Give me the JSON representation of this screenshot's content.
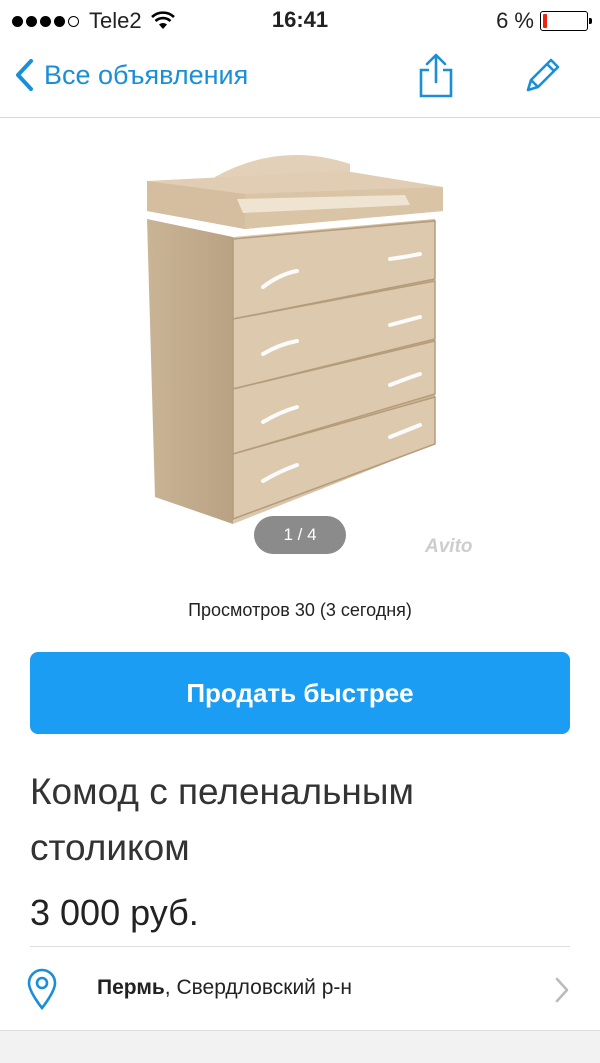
{
  "status_bar": {
    "carrier": "Tele2",
    "time": "16:41",
    "battery_text": "6 %"
  },
  "navbar": {
    "back_label": "Все объявления",
    "share_icon": "share-icon",
    "edit_icon": "pencil-icon",
    "accent": "#1a8fd8"
  },
  "gallery": {
    "counter": "1 / 4",
    "watermark": "Avito"
  },
  "listing": {
    "views": "Просмотров 30 (3 сегодня)",
    "cta_label": "Продать быстрее",
    "title": "Комод с пеленальным столиком",
    "price": "3 000 руб.",
    "city": "Пермь",
    "district": ", Свердловский р-н"
  },
  "colors": {
    "cta": "#1a9df2",
    "battery_low": "#e21"
  }
}
